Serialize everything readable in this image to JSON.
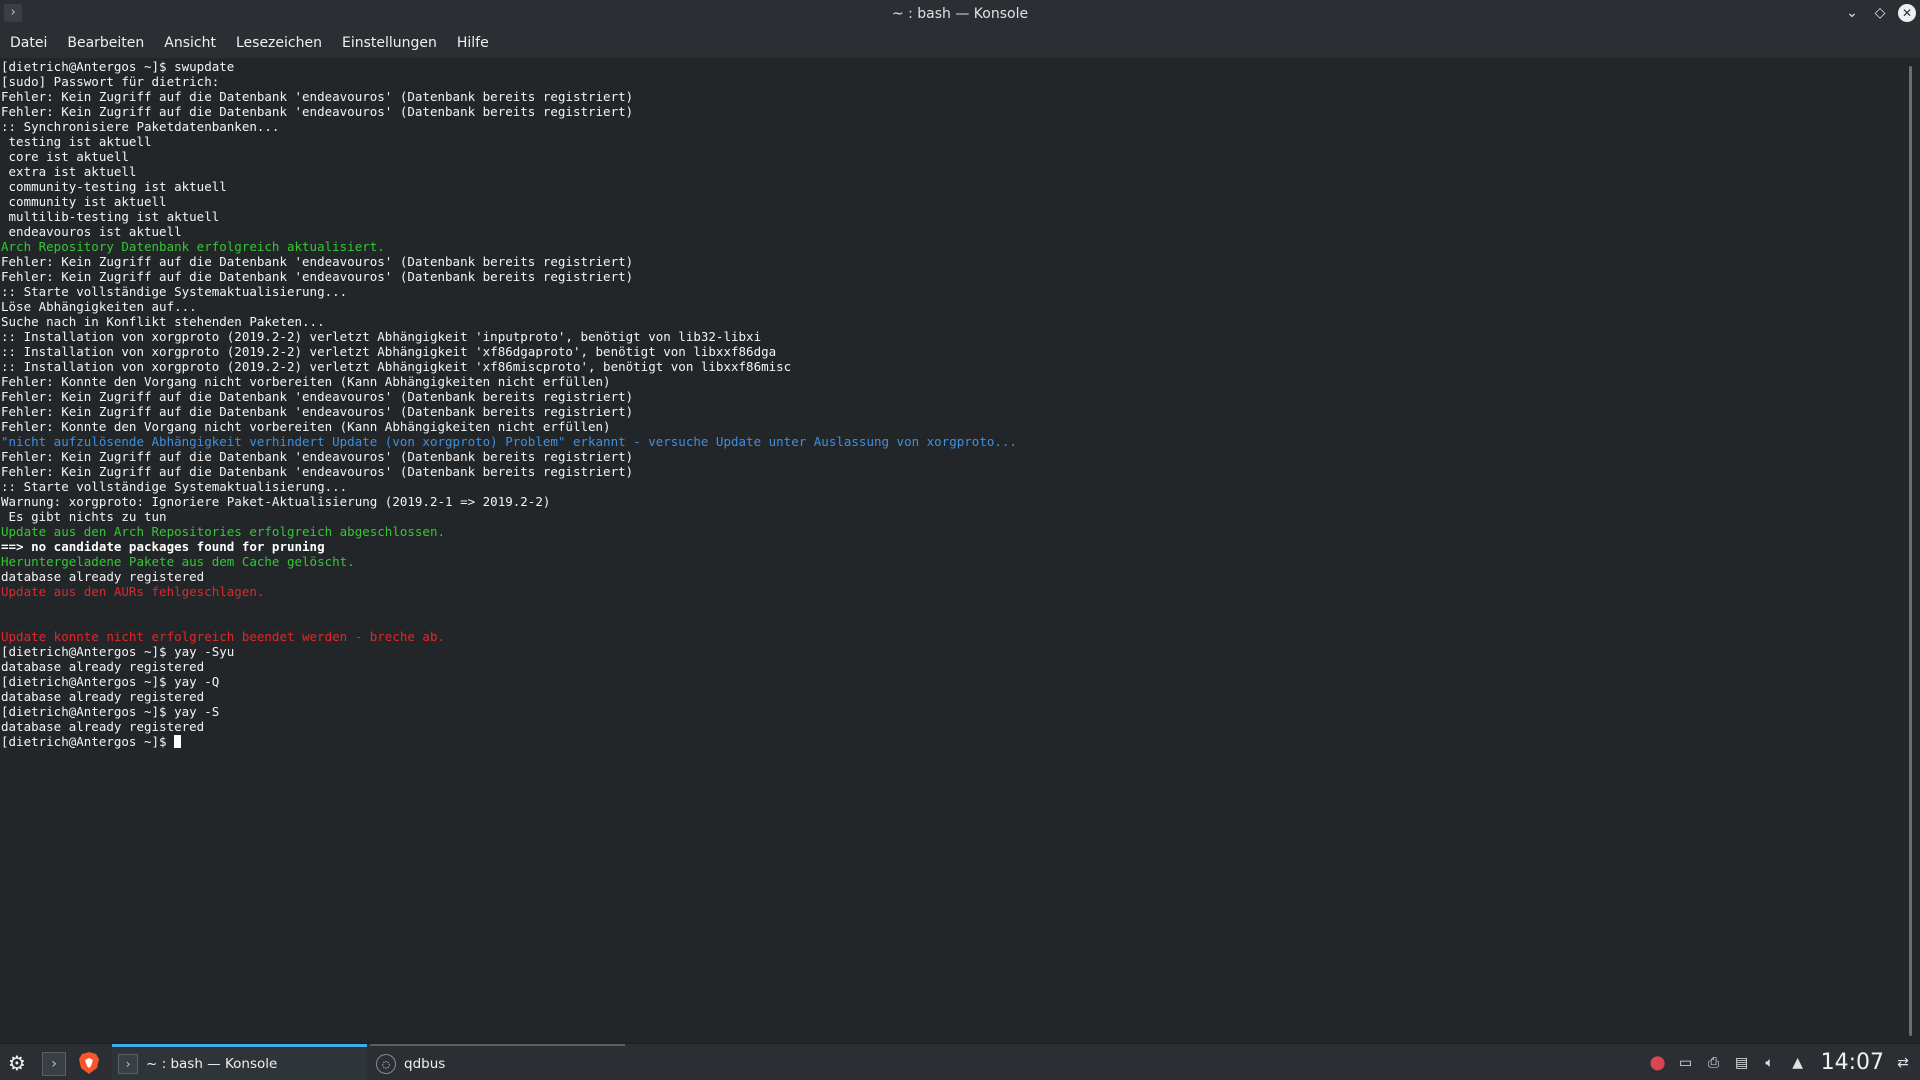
{
  "window": {
    "title": "~ : bash — Konsole",
    "controls": {
      "minimize": "⌄",
      "maximize": "◇",
      "close": "✕"
    }
  },
  "menu": [
    "Datei",
    "Bearbeiten",
    "Ansicht",
    "Lesezeichen",
    "Einstellungen",
    "Hilfe"
  ],
  "terminal": {
    "lines": [
      {
        "text": "[dietrich@Antergos ~]$ swupdate",
        "color": "white"
      },
      {
        "text": "[sudo] Passwort für dietrich:",
        "color": "white"
      },
      {
        "text": "Fehler: Kein Zugriff auf die Datenbank 'endeavouros' (Datenbank bereits registriert)",
        "color": "white"
      },
      {
        "text": "Fehler: Kein Zugriff auf die Datenbank 'endeavouros' (Datenbank bereits registriert)",
        "color": "white"
      },
      {
        "text": ":: Synchronisiere Paketdatenbanken...",
        "color": "white"
      },
      {
        "text": " testing ist aktuell",
        "color": "white"
      },
      {
        "text": " core ist aktuell",
        "color": "white"
      },
      {
        "text": " extra ist aktuell",
        "color": "white"
      },
      {
        "text": " community-testing ist aktuell",
        "color": "white"
      },
      {
        "text": " community ist aktuell",
        "color": "white"
      },
      {
        "text": " multilib-testing ist aktuell",
        "color": "white"
      },
      {
        "text": " endeavouros ist aktuell",
        "color": "white"
      },
      {
        "text": "Arch Repository Datenbank erfolgreich aktualisiert.",
        "color": "green"
      },
      {
        "text": "Fehler: Kein Zugriff auf die Datenbank 'endeavouros' (Datenbank bereits registriert)",
        "color": "white"
      },
      {
        "text": "Fehler: Kein Zugriff auf die Datenbank 'endeavouros' (Datenbank bereits registriert)",
        "color": "white"
      },
      {
        "text": ":: Starte vollständige Systemaktualisierung...",
        "color": "white"
      },
      {
        "text": "Löse Abhängigkeiten auf...",
        "color": "white"
      },
      {
        "text": "Suche nach in Konflikt stehenden Paketen...",
        "color": "white"
      },
      {
        "text": ":: Installation von xorgproto (2019.2-2) verletzt Abhängigkeit 'inputproto', benötigt von lib32-libxi",
        "color": "white"
      },
      {
        "text": ":: Installation von xorgproto (2019.2-2) verletzt Abhängigkeit 'xf86dgaproto', benötigt von libxxf86dga",
        "color": "white"
      },
      {
        "text": ":: Installation von xorgproto (2019.2-2) verletzt Abhängigkeit 'xf86miscproto', benötigt von libxxf86misc",
        "color": "white"
      },
      {
        "text": "Fehler: Konnte den Vorgang nicht vorbereiten (Kann Abhängigkeiten nicht erfüllen)",
        "color": "white"
      },
      {
        "text": "Fehler: Kein Zugriff auf die Datenbank 'endeavouros' (Datenbank bereits registriert)",
        "color": "white"
      },
      {
        "text": "Fehler: Kein Zugriff auf die Datenbank 'endeavouros' (Datenbank bereits registriert)",
        "color": "white"
      },
      {
        "text": "Fehler: Konnte den Vorgang nicht vorbereiten (Kann Abhängigkeiten nicht erfüllen)",
        "color": "white"
      },
      {
        "text": "\"nicht aufzulösende Abhängigkeit verhindert Update (von xorgproto) Problem\" erkannt - versuche Update unter Auslassung von xorgproto...",
        "color": "blue"
      },
      {
        "text": "Fehler: Kein Zugriff auf die Datenbank 'endeavouros' (Datenbank bereits registriert)",
        "color": "white"
      },
      {
        "text": "Fehler: Kein Zugriff auf die Datenbank 'endeavouros' (Datenbank bereits registriert)",
        "color": "white"
      },
      {
        "text": ":: Starte vollständige Systemaktualisierung...",
        "color": "white"
      },
      {
        "text": "Warnung: xorgproto: Ignoriere Paket-Aktualisierung (2019.2-1 => 2019.2-2)",
        "color": "white"
      },
      {
        "text": " Es gibt nichts zu tun",
        "color": "white"
      },
      {
        "text": "Update aus den Arch Repositories erfolgreich abgeschlossen.",
        "color": "green"
      },
      {
        "text": "==> no candidate packages found for pruning",
        "color": "bold"
      },
      {
        "text": "Heruntergeladene Pakete aus dem Cache gelöscht.",
        "color": "green"
      },
      {
        "text": "database already registered",
        "color": "white"
      },
      {
        "text": "Update aus den AURs fehlgeschlagen.",
        "color": "red"
      },
      {
        "text": "",
        "color": "white"
      },
      {
        "text": "",
        "color": "white"
      },
      {
        "text": "Update konnte nicht erfolgreich beendet werden - breche ab.",
        "color": "red"
      },
      {
        "text": "[dietrich@Antergos ~]$ yay -Syu",
        "color": "white"
      },
      {
        "text": "database already registered",
        "color": "white"
      },
      {
        "text": "[dietrich@Antergos ~]$ yay -Q",
        "color": "white"
      },
      {
        "text": "database already registered",
        "color": "white"
      },
      {
        "text": "[dietrich@Antergos ~]$ yay -S",
        "color": "white"
      },
      {
        "text": "database already registered",
        "color": "white"
      }
    ],
    "prompt": "[dietrich@Antergos ~]$ "
  },
  "taskbar": {
    "tasks": [
      {
        "label": "~ : bash — Konsole",
        "active": true
      },
      {
        "label": "qdbus",
        "active": false
      }
    ],
    "clock": "14:07"
  }
}
